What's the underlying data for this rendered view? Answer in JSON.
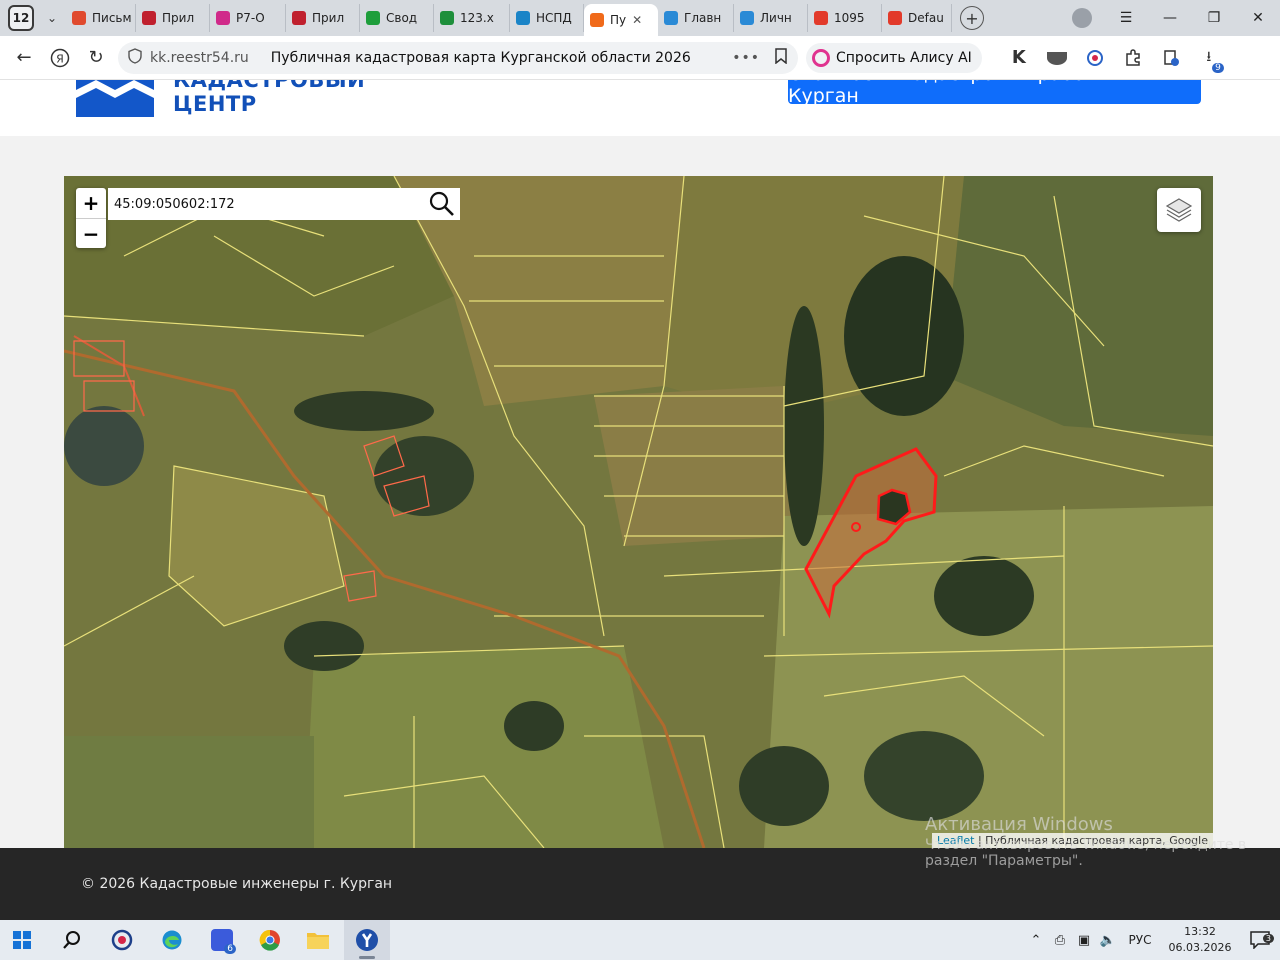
{
  "browser": {
    "tab_count": "12",
    "tabs": [
      {
        "label": "Письм",
        "color": "#e04a2e"
      },
      {
        "label": "Прил",
        "color": "#c0202e"
      },
      {
        "label": "Р7-О",
        "color": "#d02a8a"
      },
      {
        "label": "Прил",
        "color": "#c0202e"
      },
      {
        "label": "Свод",
        "color": "#1e9e3b"
      },
      {
        "label": "123.x",
        "color": "#1e8f3b"
      },
      {
        "label": "НСПД",
        "color": "#1a84c7"
      },
      {
        "label": "Пу",
        "color": "#f06a1a"
      },
      {
        "label": "Главн",
        "color": "#2a8ad6"
      },
      {
        "label": "Личн",
        "color": "#2a8ad6"
      },
      {
        "label": "1095",
        "color": "#e23a2a"
      },
      {
        "label": "Defau",
        "color": "#e23a2a"
      }
    ],
    "close_tab_symbol": "✕",
    "new_tab_symbol": "+",
    "window_controls": {
      "menu": "☰",
      "minimize": "—",
      "restore": "❐",
      "close": "✕"
    }
  },
  "address_bar": {
    "domain": "kk.reestr54.ru",
    "page_title": "Публичная кадастровая карта Курганской области 2026",
    "more": "•••",
    "alice_label": "Спросить Алису AI",
    "downloads_badge": "9"
  },
  "site": {
    "logo_line1": "КАДАСТРОВЫЙ",
    "logo_line2": "ЦЕНТР",
    "cta_label": "Стоимость кадастровых работ в г. Курган"
  },
  "map": {
    "zoom_in": "+",
    "zoom_out": "−",
    "search_value": "45:09:050602:172",
    "attribution_link": "Leaflet",
    "attribution_text": " | Публичная кадастровая карта, Google",
    "colors": {
      "parcel_outline": "#e8e07a",
      "selected": "#ff1a1a",
      "road": "#b06a2e",
      "forest": "#2f3f25",
      "field": "#8a8a4a"
    }
  },
  "footer": {
    "copyright": "© 2026 Кадастровые инженеры г. Курган"
  },
  "watermark": {
    "line1": "Активация Windows",
    "line2": "Чтобы активировать Windows, перейдите в",
    "line3": "раздел \"Параметры\"."
  },
  "taskbar": {
    "language": "РУС",
    "time": "13:32",
    "date": "06.03.2026",
    "notifications": "3",
    "chat_badge": "6"
  }
}
